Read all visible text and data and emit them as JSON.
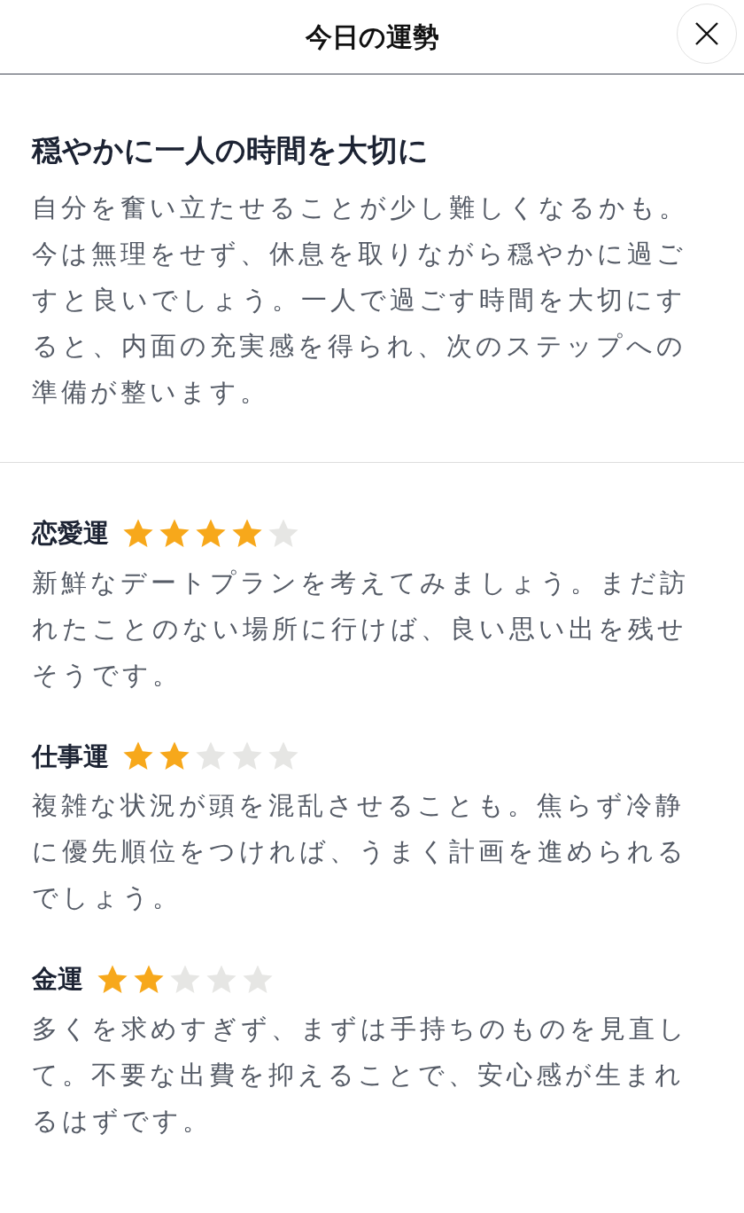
{
  "header": {
    "title": "今日の運勢"
  },
  "summary": {
    "title": "穏やかに一人の時間を大切に",
    "text": "自分を奮い立たせることが少し難しくなるかも。今は無理をせず、休息を取りながら穏やかに過ごすと良いでしょう。一人で過ごす時間を大切にすると、内面の充実感を得られ、次のステップへの準備が整います。"
  },
  "categories": [
    {
      "name": "恋愛運",
      "stars": 4,
      "text": "新鮮なデートプランを考えてみましょう。まだ訪れたことのない場所に行けば、良い思い出を残せそうです。"
    },
    {
      "name": "仕事運",
      "stars": 2,
      "text": "複雑な状況が頭を混乱させることも。焦らず冷静に優先順位をつければ、うまく計画を進められるでしょう。"
    },
    {
      "name": "金運",
      "stars": 2,
      "text": "多くを求めすぎず、まずは手持ちのものを見直して。不要な出費を抑えることで、安心感が生まれるはずです。"
    }
  ]
}
